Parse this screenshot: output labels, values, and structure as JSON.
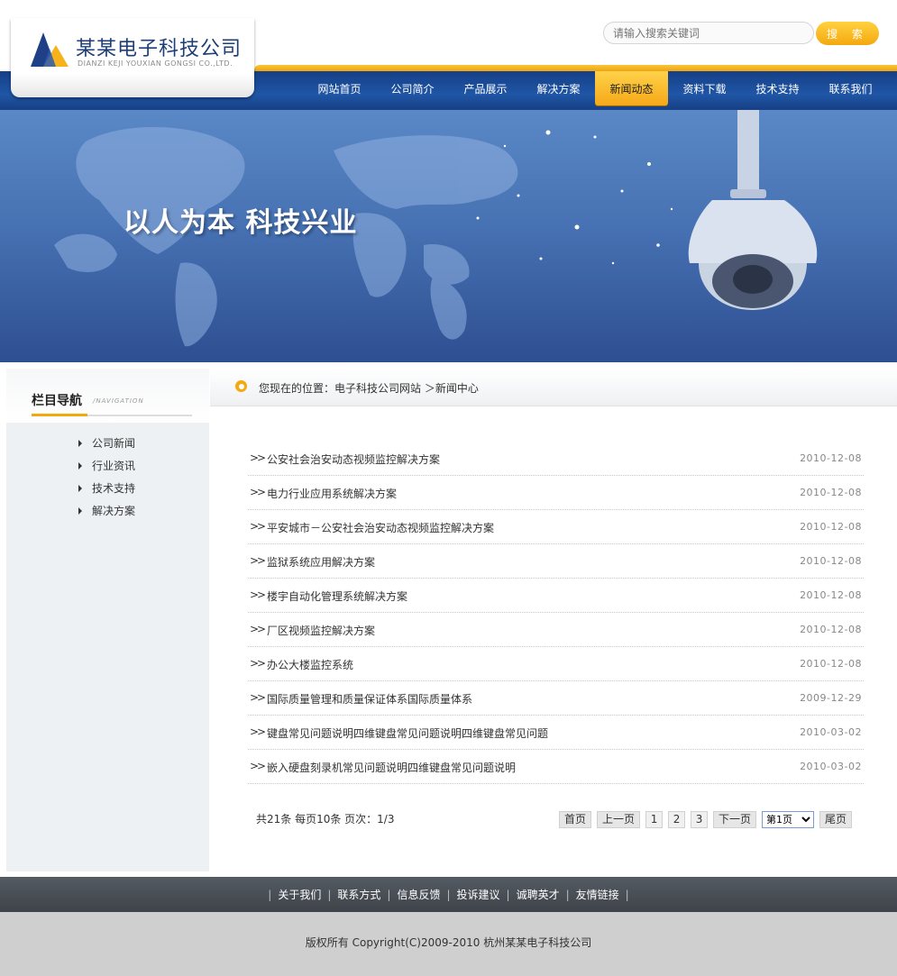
{
  "brand": {
    "name": "某某电子科技公司",
    "sub": "DIANZI KEJI YOUXIAN GONGSI CO.,LTD."
  },
  "search": {
    "placeholder": "请输入搜索关键词",
    "button_label": "搜 索"
  },
  "nav": {
    "items": [
      {
        "label": "网站首页"
      },
      {
        "label": "公司简介"
      },
      {
        "label": "产品展示"
      },
      {
        "label": "解决方案"
      },
      {
        "label": "新闻动态"
      },
      {
        "label": "资料下载"
      },
      {
        "label": "技术支持"
      },
      {
        "label": "联系我们"
      }
    ]
  },
  "banner": {
    "slogan": "以人为本 科技兴业"
  },
  "sidebar": {
    "title": "栏目导航",
    "subtitle": "/NAVIGATION",
    "items": [
      {
        "label": "公司新闻"
      },
      {
        "label": "行业资讯"
      },
      {
        "label": "技术支持"
      },
      {
        "label": "解决方案"
      }
    ]
  },
  "breadcrumb": {
    "text": "您现在的位置：电子科技公司网站 ＞新闻中心"
  },
  "news": {
    "items": [
      {
        "title": "公安社会治安动态视频监控解决方案",
        "date": "2010-12-08"
      },
      {
        "title": "电力行业应用系统解决方案",
        "date": "2010-12-08"
      },
      {
        "title": "平安城市－公安社会治安动态视频监控解决方案",
        "date": "2010-12-08"
      },
      {
        "title": "监狱系统应用解决方案",
        "date": "2010-12-08"
      },
      {
        "title": "楼宇自动化管理系统解决方案",
        "date": "2010-12-08"
      },
      {
        "title": "厂区视频监控解决方案",
        "date": "2010-12-08"
      },
      {
        "title": "办公大楼监控系统",
        "date": "2010-12-08"
      },
      {
        "title": "国际质量管理和质量保证体系国际质量体系",
        "date": "2009-12-29"
      },
      {
        "title": "键盘常见问题说明四维键盘常见问题说明四维键盘常见问题",
        "date": "2010-03-02"
      },
      {
        "title": "嵌入硬盘刻录机常见问题说明四维键盘常见问题说明",
        "date": "2010-03-02"
      }
    ]
  },
  "pager": {
    "info": "共21条  每页10条  页次：1/3",
    "first": "首页",
    "prev": "上一页",
    "pages": [
      "1",
      "2",
      "3"
    ],
    "next": "下一页",
    "select_value": "第1页",
    "last": "尾页"
  },
  "footer": {
    "links": [
      {
        "label": "关于我们"
      },
      {
        "label": "联系方式"
      },
      {
        "label": "信息反馈"
      },
      {
        "label": "投诉建议"
      },
      {
        "label": "诚聘英才"
      },
      {
        "label": "友情链接"
      }
    ],
    "copyright": "版权所有  Copyright(C)2009-2010 杭州某某电子科技公司"
  },
  "colors": {
    "nav_blue": "#1f56a6",
    "accent_orange": "#f5a80f",
    "footer_dark": "#4a4f56"
  }
}
